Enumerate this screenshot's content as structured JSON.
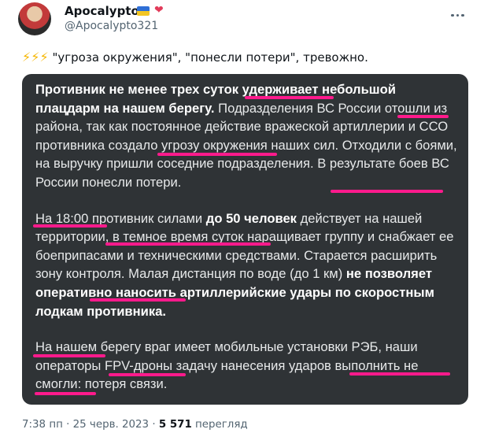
{
  "author": {
    "name": "Apocalypto",
    "handle": "@Apocalypto321",
    "badge_icons": [
      "ukraine-flag-icon",
      "heart-icon"
    ]
  },
  "post": {
    "caption_text": "\"угроза окружения\", \"понесли потери\", тревожно.",
    "caption_icons": [
      "lightning-icon",
      "lightning-icon",
      "lightning-icon"
    ],
    "image_text": {
      "p1_bold": "Противник не менее трех суток удерживает небольшой плацдарм на нашем берегу.",
      "p1_rest": " Подразделения ВС России отошли из района, так как постоянное действие вражеской артиллерии и ССО противника создало угрозу окружения наших сил. Отходили с боями, на выручку пришли соседние подразделения. В результате боев ВС России понесли потери.",
      "p2_a": "На 18:00 противник силами ",
      "p2_bold1": "до 50 человек",
      "p2_b": " действует на нашей территории, в темное время суток наращивает группу и снабжает ее боеприпасами и техническими средствами. Старается расширить зону контроля. Малая дистанция по воде (до 1 км) ",
      "p2_bold2": "не позволяет оперативно наносить артиллерийские удары по скоростным лодкам противника.",
      "p3": "На нашем берегу враг имеет мобильные установки РЭБ, наши операторы FPV-дроны задачу нанесения ударов выполнить не смогли: потеря связи."
    },
    "underline_color": "#ff1a8c"
  },
  "meta": {
    "time": "7:38 пп",
    "sep": " · ",
    "date": "25 черв. 2023",
    "sep2": " · ",
    "views": "5 571",
    "views_label": " перегляд"
  },
  "colors": {
    "text": "#0f1419",
    "secondary": "#536471",
    "card_bg": "#2f3336",
    "card_text": "#e7e9ea",
    "bolt": "#f6b600"
  }
}
